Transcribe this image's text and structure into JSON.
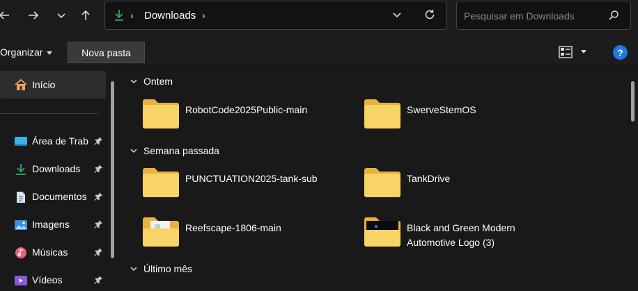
{
  "nav": {
    "back_icon": "arrow-left-icon",
    "forward_icon": "arrow-right-icon",
    "recent_icon": "chevron-down-icon",
    "up_icon": "arrow-up-icon"
  },
  "address": {
    "sep": "›",
    "crumb": "Downloads"
  },
  "search": {
    "placeholder": "Pesquisar em Downloads"
  },
  "commandbar": {
    "organize_label": "Organizar",
    "new_folder_label": "Nova pasta",
    "help_label": "?"
  },
  "sidebar": {
    "home_label": "Início",
    "items": [
      {
        "label": "Área de Trab",
        "icon": "desktop-icon"
      },
      {
        "label": "Downloads",
        "icon": "download-icon"
      },
      {
        "label": "Documentos",
        "icon": "document-icon"
      },
      {
        "label": "Imagens",
        "icon": "image-icon"
      },
      {
        "label": "Músicas",
        "icon": "music-icon"
      },
      {
        "label": "Vídeos",
        "icon": "video-icon"
      }
    ]
  },
  "groups": [
    {
      "title": "Ontem",
      "items": [
        "RobotCode2025Public-main",
        "SwerveStemOS"
      ]
    },
    {
      "title": "Semana passada",
      "items": [
        "PUNCTUATION2025-tank-sub",
        "TankDrive",
        "Reefscape-1806-main",
        "Black and Green Modern",
        "Automotive Logo (3)"
      ]
    },
    {
      "title": "Último mês",
      "items": []
    }
  ],
  "colors": {
    "background": "#191919",
    "folder": "#f8cf5c",
    "accent": "#1e7ae0",
    "download_green": "#2ea86e"
  }
}
